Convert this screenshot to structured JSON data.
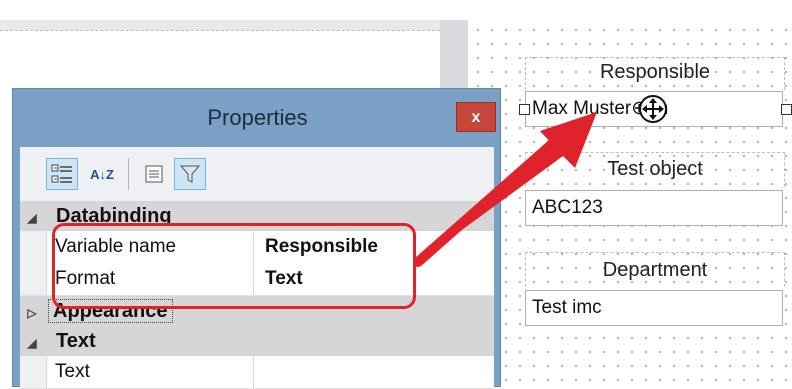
{
  "designer": {
    "labels": {
      "responsible": "Responsible",
      "test_object": "Test object",
      "department": "Department"
    },
    "fields": {
      "responsible_value": "Max Muster⊕hn",
      "test_object_value": "ABC123",
      "department_value": "Test imc"
    }
  },
  "properties": {
    "title": "Properties",
    "close_label": "x",
    "toolbar": {
      "categorized_icon": "categorized-view-icon",
      "alphabetical_label": "A↓Z",
      "property_pages_icon": "property-pages-icon",
      "filter_icon": "filter-icon"
    },
    "categories": [
      {
        "name": "Databinding",
        "expanded": true,
        "rows": [
          {
            "name": "Variable name",
            "value": "Responsible"
          },
          {
            "name": "Format",
            "value": "Text"
          }
        ]
      },
      {
        "name": "Appearance",
        "expanded": false,
        "rows": []
      },
      {
        "name": "Text",
        "expanded": true,
        "rows": [
          {
            "name": "Text",
            "value": ""
          }
        ]
      }
    ]
  },
  "colors": {
    "annotation_red": "#e0232b",
    "window_frame": "#7aa0c6",
    "close_button": "#c7463c"
  }
}
